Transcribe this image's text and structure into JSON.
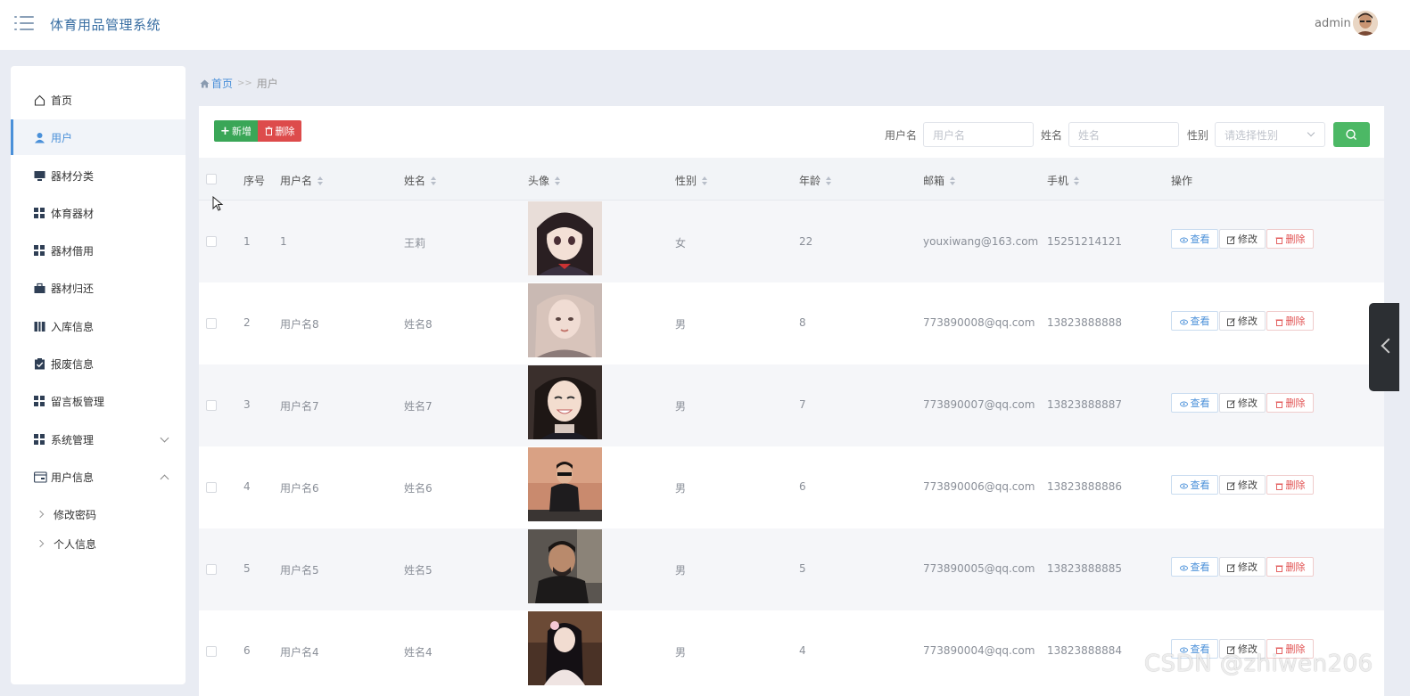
{
  "header": {
    "app_title": "体育用品管理系统",
    "user_name": "admin"
  },
  "sidebar": {
    "items": [
      {
        "label": "首页",
        "icon": "home-icon"
      },
      {
        "label": "用户",
        "icon": "user-icon",
        "active": true
      },
      {
        "label": "器材分类",
        "icon": "monitor-icon"
      },
      {
        "label": "体育器材",
        "icon": "grid-icon"
      },
      {
        "label": "器材借用",
        "icon": "grid-icon"
      },
      {
        "label": "器材归还",
        "icon": "briefcase-icon"
      },
      {
        "label": "入库信息",
        "icon": "book-icon"
      },
      {
        "label": "报废信息",
        "icon": "clipboard-check-icon"
      },
      {
        "label": "留言板管理",
        "icon": "grid-icon"
      },
      {
        "label": "系统管理",
        "icon": "grid-icon"
      },
      {
        "label": "用户信息",
        "icon": "card-icon"
      }
    ],
    "sub_items": [
      {
        "label": "修改密码"
      },
      {
        "label": "个人信息"
      }
    ]
  },
  "breadcrumb": {
    "home": "首页",
    "separator": ">>",
    "current": "用户"
  },
  "toolbar": {
    "add_label": "新增",
    "delete_label": "删除",
    "search": {
      "username_label": "用户名",
      "username_placeholder": "用户名",
      "name_label": "姓名",
      "name_placeholder": "姓名",
      "gender_label": "性别",
      "gender_placeholder": "请选择性别"
    }
  },
  "table": {
    "columns": {
      "index": "序号",
      "username": "用户名",
      "name": "姓名",
      "avatar": "头像",
      "gender": "性别",
      "age": "年龄",
      "email": "邮箱",
      "phone": "手机",
      "actions": "操作"
    },
    "action_labels": {
      "view": "查看",
      "edit": "修改",
      "delete": "删除"
    },
    "rows": [
      {
        "index": "1",
        "username": "1",
        "name": "王莉",
        "gender": "女",
        "age": "22",
        "email": "youxiwang@163.com",
        "phone": "15251214121"
      },
      {
        "index": "2",
        "username": "用户名8",
        "name": "姓名8",
        "gender": "男",
        "age": "8",
        "email": "773890008@qq.com",
        "phone": "13823888888"
      },
      {
        "index": "3",
        "username": "用户名7",
        "name": "姓名7",
        "gender": "男",
        "age": "7",
        "email": "773890007@qq.com",
        "phone": "13823888887"
      },
      {
        "index": "4",
        "username": "用户名6",
        "name": "姓名6",
        "gender": "男",
        "age": "6",
        "email": "773890006@qq.com",
        "phone": "13823888886"
      },
      {
        "index": "5",
        "username": "用户名5",
        "name": "姓名5",
        "gender": "男",
        "age": "5",
        "email": "773890005@qq.com",
        "phone": "13823888885"
      },
      {
        "index": "6",
        "username": "用户名4",
        "name": "姓名4",
        "gender": "男",
        "age": "4",
        "email": "773890004@qq.com",
        "phone": "13823888884"
      }
    ]
  },
  "watermark": "CSDN @zhiwen206",
  "colors": {
    "accent": "#4a90d9",
    "add": "#3aa657",
    "delete": "#dd4b4b",
    "search": "#4cb865"
  }
}
